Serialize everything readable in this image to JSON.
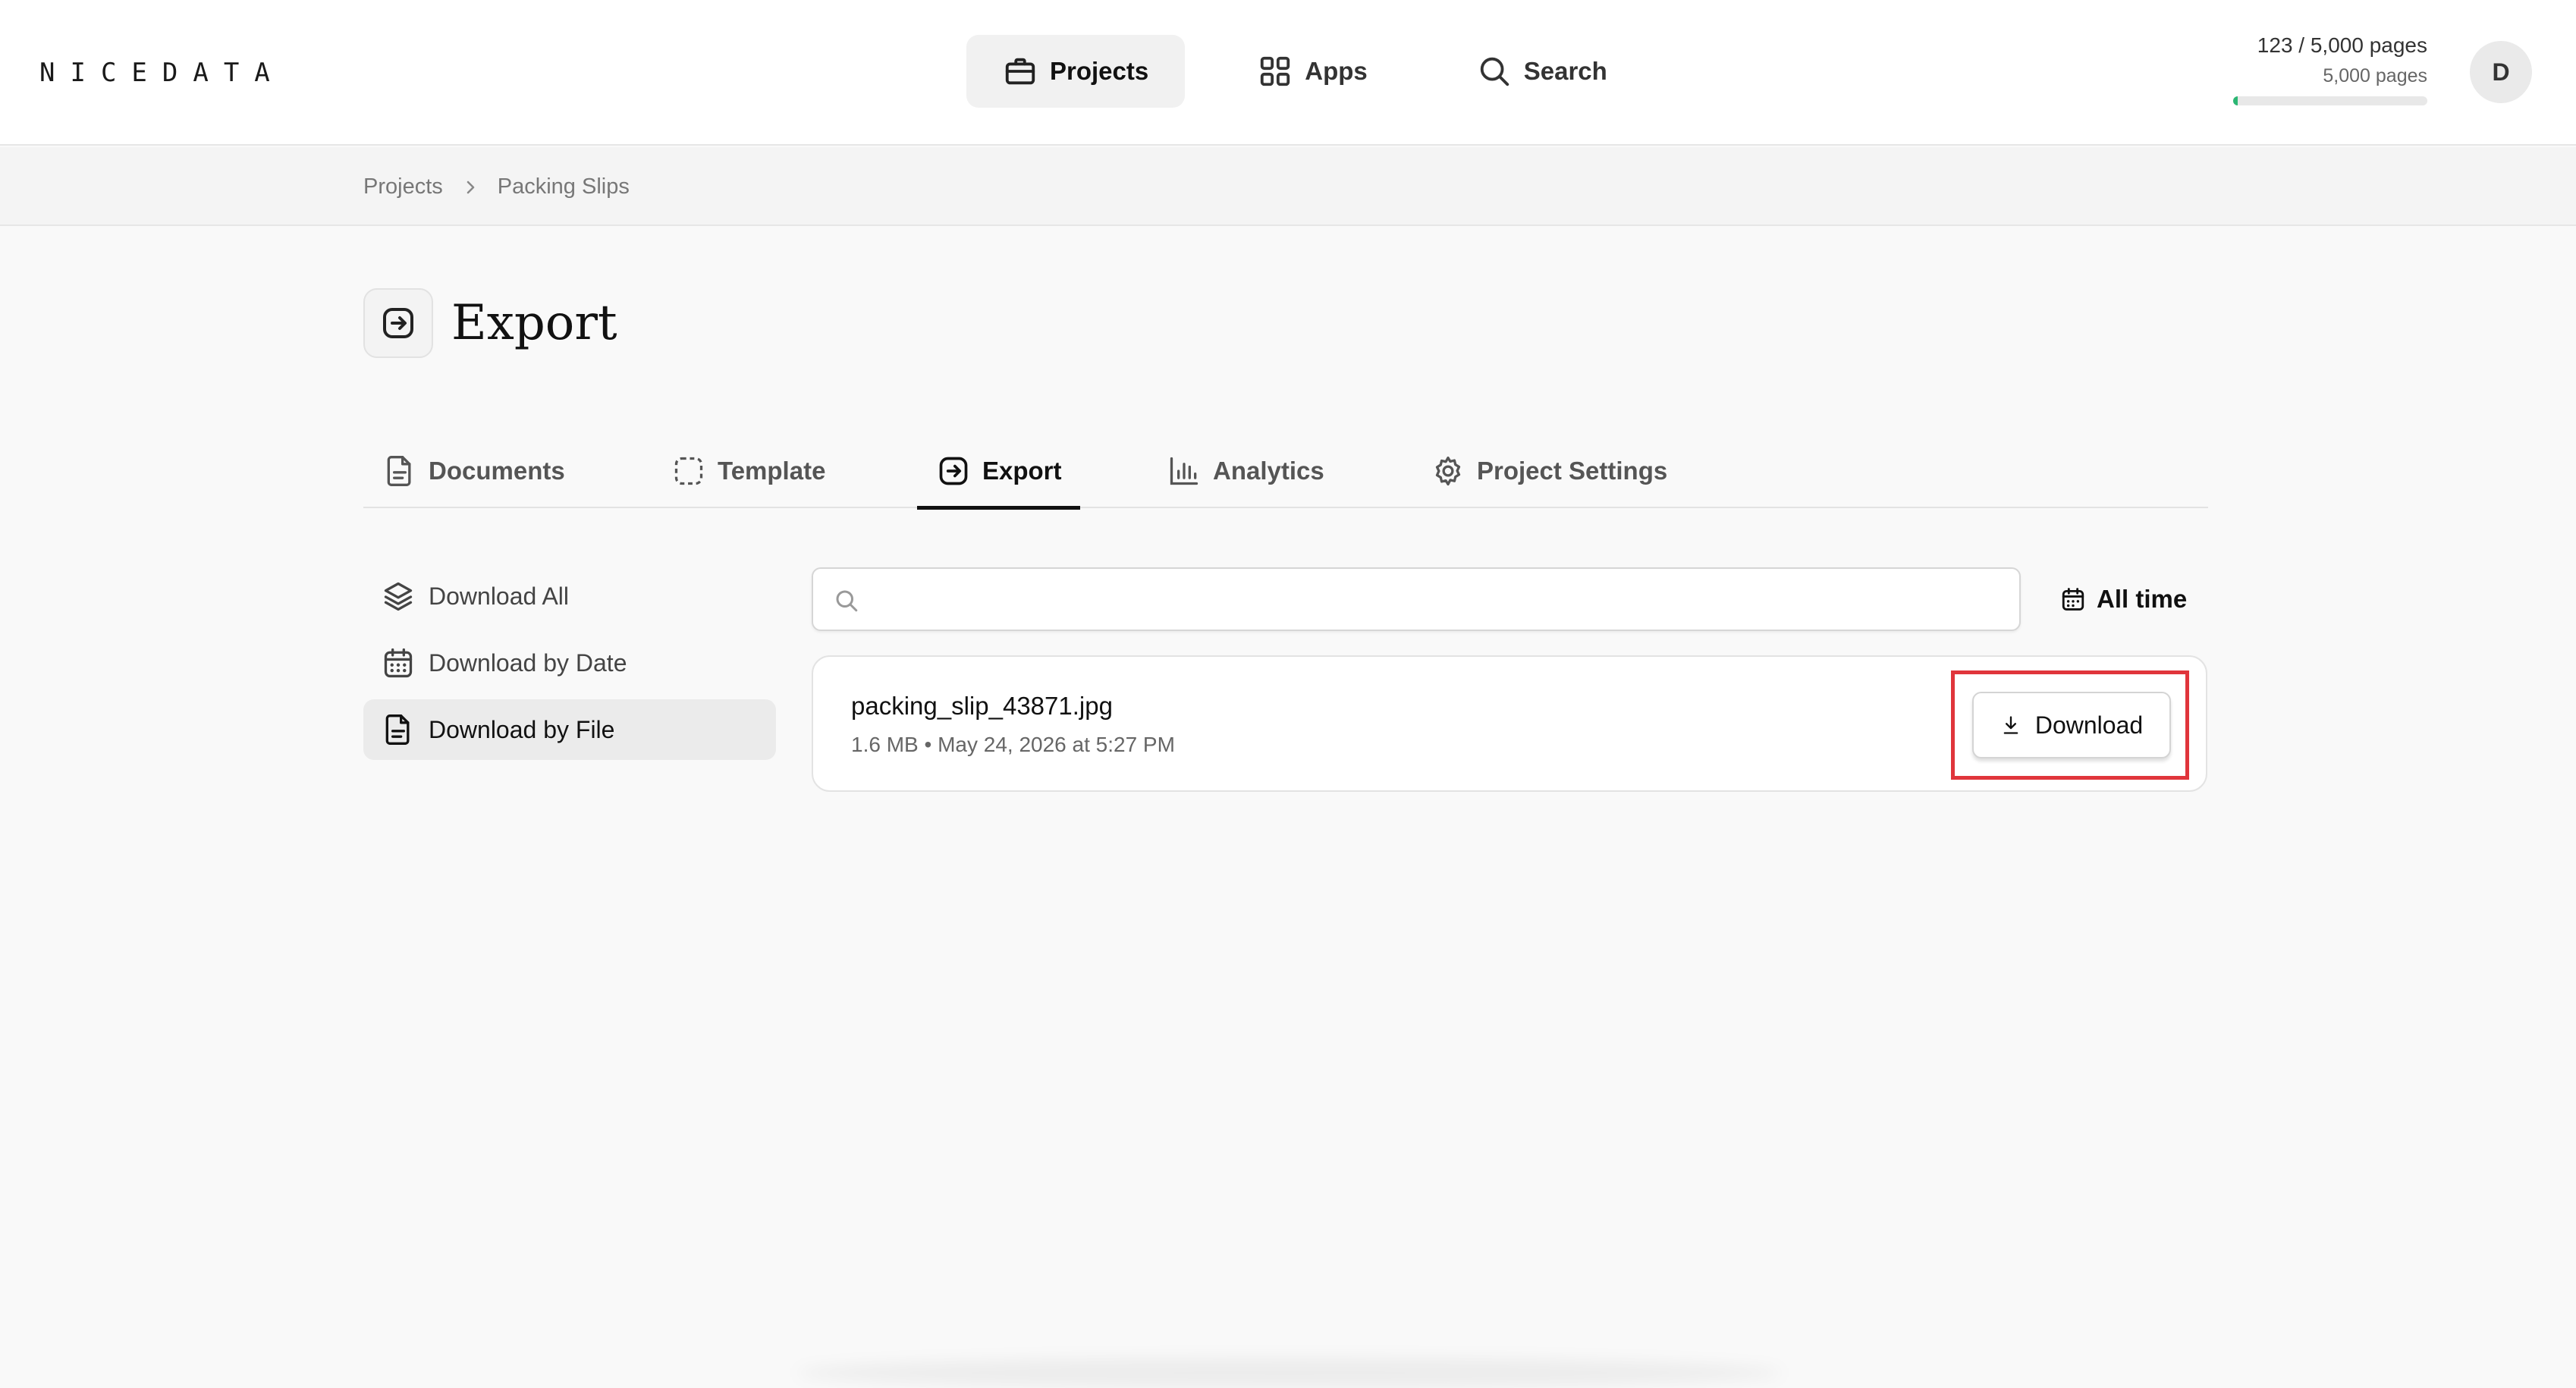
{
  "app": {
    "logo": "NICEDATA"
  },
  "nav": {
    "items": [
      {
        "label": "Projects",
        "icon": "briefcase-icon",
        "active": true
      },
      {
        "label": "Apps",
        "icon": "grid-icon",
        "active": false
      },
      {
        "label": "Search",
        "icon": "search-icon",
        "active": false
      }
    ]
  },
  "usage": {
    "main": "123 / 5,000 pages",
    "sub": "5,000 pages",
    "fraction": 0.0246,
    "bar_color": "#2bb673"
  },
  "user": {
    "avatar_initial": "D"
  },
  "breadcrumb": {
    "root": "Projects",
    "current": "Packing Slips"
  },
  "page": {
    "title": "Export",
    "icon": "arrow-right-square-icon"
  },
  "tabs": [
    {
      "label": "Documents",
      "icon": "file-icon",
      "active": false
    },
    {
      "label": "Template",
      "icon": "dashed-square-icon",
      "active": false
    },
    {
      "label": "Export",
      "icon": "arrow-right-square-icon",
      "active": true
    },
    {
      "label": "Analytics",
      "icon": "bar-chart-icon",
      "active": false
    },
    {
      "label": "Project Settings",
      "icon": "gear-icon",
      "active": false
    }
  ],
  "sidebar": {
    "items": [
      {
        "label": "Download All",
        "icon": "layers-icon",
        "active": false
      },
      {
        "label": "Download by Date",
        "icon": "calendar-icon",
        "active": false
      },
      {
        "label": "Download by File",
        "icon": "file-icon",
        "active": true
      }
    ]
  },
  "search": {
    "value": "",
    "placeholder": ""
  },
  "date_filter": {
    "label": "All time"
  },
  "files": [
    {
      "name": "packing_slip_43871.jpg",
      "meta": "1.6 MB • May 24, 2026 at 5:27 PM",
      "button_label": "Download"
    }
  ],
  "colors": {
    "highlight": "#e0353b",
    "accent": "#111111"
  }
}
